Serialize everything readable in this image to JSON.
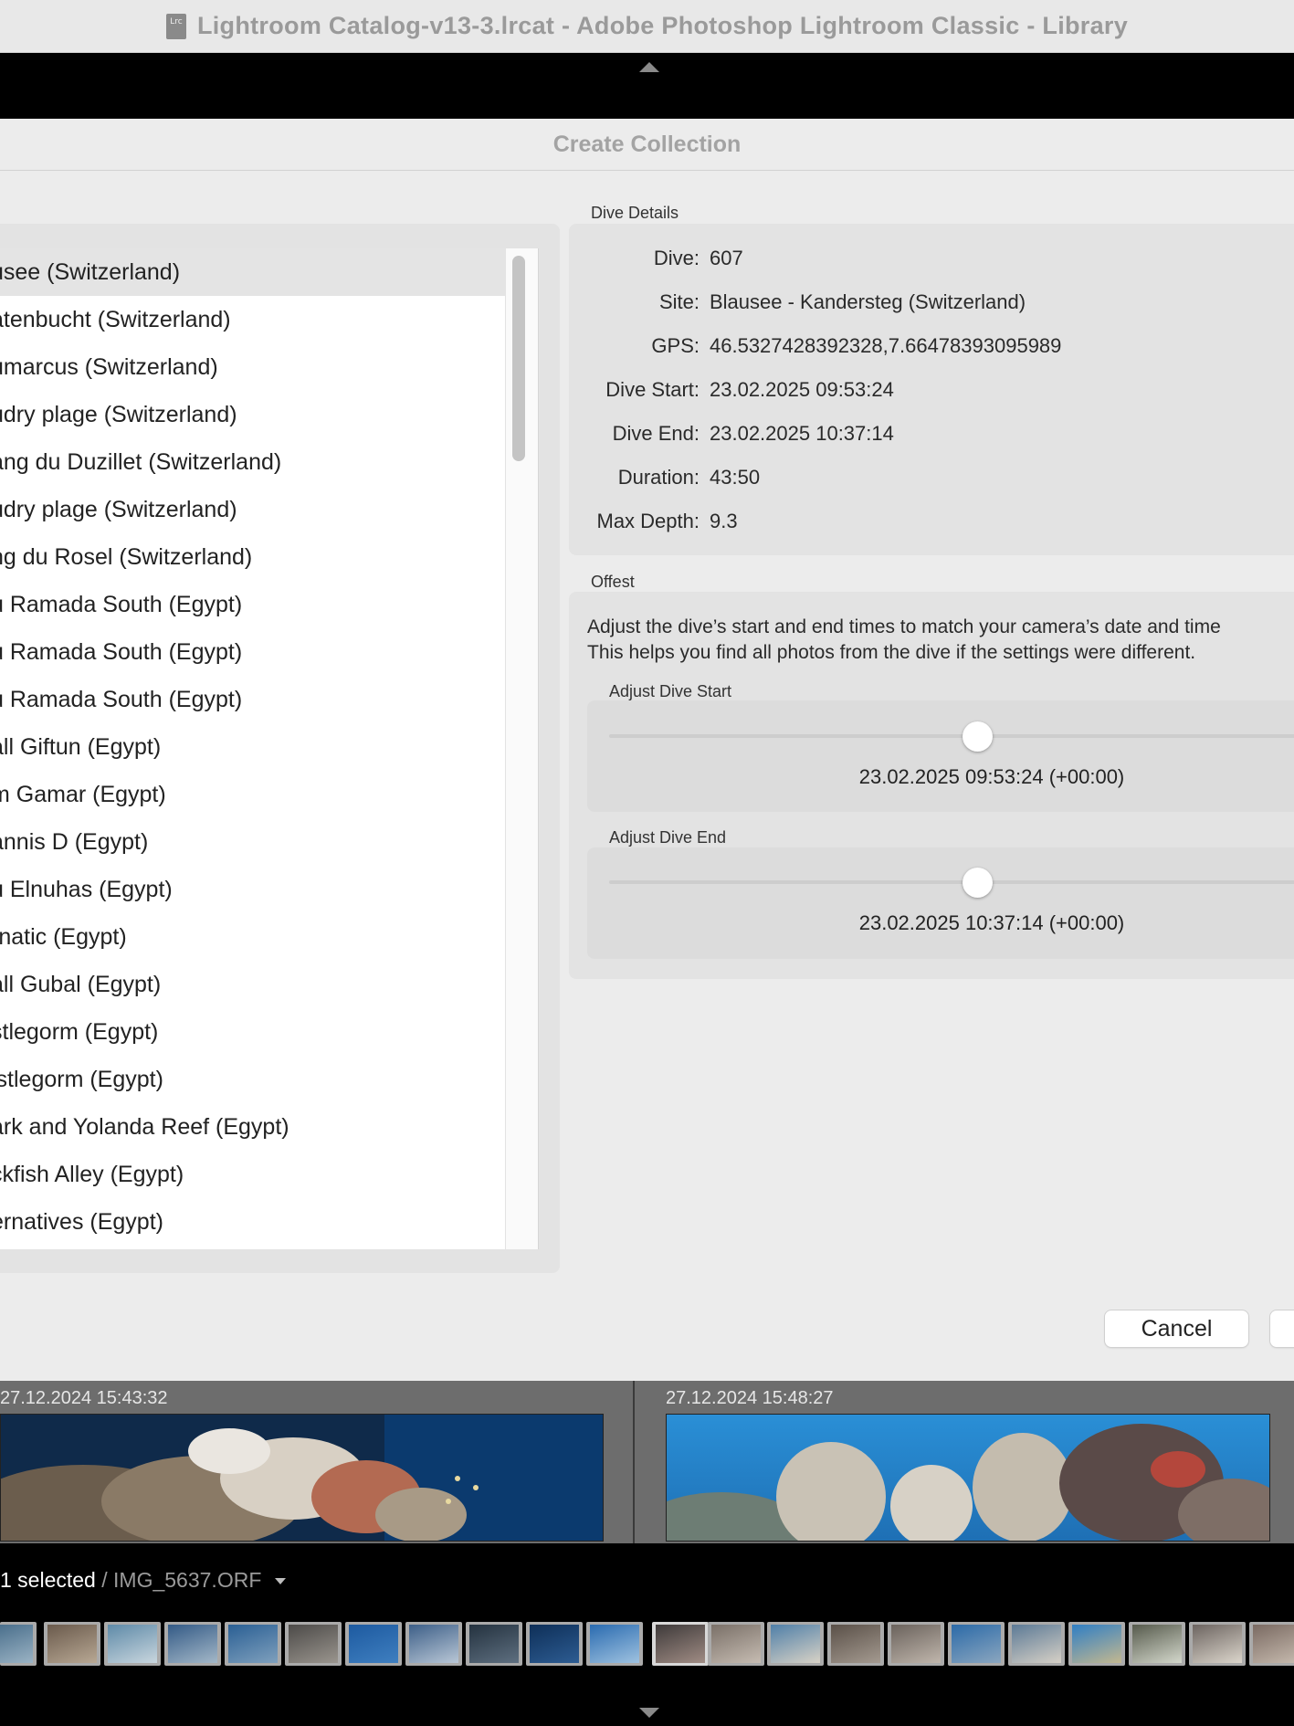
{
  "window": {
    "title": "Lightroom Catalog-v13-3.lrcat - Adobe Photoshop Lightroom Classic - Library",
    "icon_text": "Lrc"
  },
  "dialog": {
    "title": "Create Collection",
    "sites": [
      "usee (Switzerland)",
      "atenbucht (Switzerland)",
      "umarcus (Switzerland)",
      "udry plage (Switzerland)",
      "ang du Duzillet (Switzerland)",
      "udry plage (Switzerland)",
      "ng du Rosel (Switzerland)",
      "u Ramada South (Egypt)",
      "u Ramada South (Egypt)",
      "u Ramada South (Egypt)",
      "all Giftun (Egypt)",
      "m Gamar (Egypt)",
      "annis D (Egypt)",
      "u Elnuhas (Egypt)",
      "rnatic (Egypt)",
      "all Gubal (Egypt)",
      "stlegorm (Egypt)",
      "istlegorm (Egypt)",
      "ark and Yolanda Reef (Egypt)",
      "ckfish Alley (Egypt)",
      "ernatives (Egypt)"
    ],
    "dive_details": {
      "heading": "Dive Details",
      "rows": [
        {
          "label": "Dive:",
          "value": "607"
        },
        {
          "label": "Site:",
          "value": "Blausee - Kandersteg (Switzerland)"
        },
        {
          "label": "GPS:",
          "value": "46.5327428392328,7.66478393095989"
        },
        {
          "label": "Dive Start:",
          "value": "23.02.2025 09:53:24"
        },
        {
          "label": "Dive End:",
          "value": "23.02.2025 10:37:14"
        },
        {
          "label": "Duration:",
          "value": "43:50"
        },
        {
          "label": "Max Depth:",
          "value": "9.3"
        }
      ]
    },
    "offset": {
      "heading": "Offest",
      "description_line1": "Adjust the dive’s start and end times to match your camera’s date and time",
      "description_line2": "This helps you find all photos from the dive if the settings were different.",
      "start": {
        "label": "Adjust Dive Start",
        "readout": "23.02.2025 09:53:24 (+00:00)",
        "position_fraction": 0.5
      },
      "end": {
        "label": "Adjust Dive End",
        "readout": "23.02.2025 10:37:14 (+00:00)",
        "position_fraction": 0.5
      }
    },
    "cancel_label": "Cancel"
  },
  "photos": [
    {
      "timestamp": "27.12.2024 15:43:32"
    },
    {
      "timestamp": "27.12.2024 15:48:27"
    }
  ],
  "info_bar": {
    "selected_text": "1 selected",
    "file_text": "/ IMG_5637.ORF"
  },
  "colors": {
    "accent_blue": "#1b5fa8",
    "water_blue": "#2a7fc4"
  }
}
